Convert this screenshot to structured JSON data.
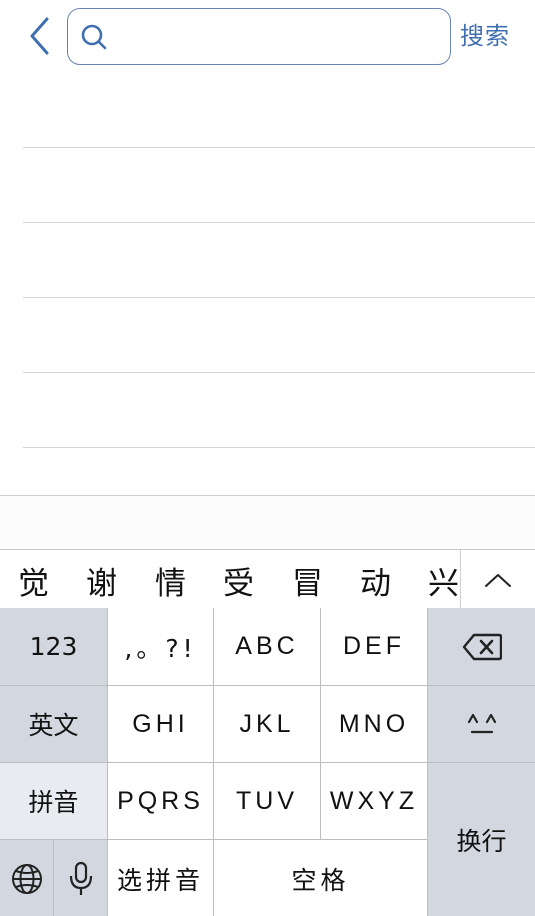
{
  "header": {
    "back_icon": "chevron-left-icon",
    "search_icon": "search-icon",
    "search_value": "",
    "search_placeholder": "",
    "search_button": "搜索",
    "accent_color": "#3f6fb0"
  },
  "results": {
    "row_count": 5
  },
  "keyboard": {
    "candidates": [
      "觉",
      "谢",
      "情",
      "受",
      "冒",
      "动",
      "兴"
    ],
    "expand_icon": "chevron-up-icon",
    "keys": {
      "num": "123",
      "punct": ",。?!",
      "abc": "ABC",
      "def": "DEF",
      "delete_icon": "backspace-icon",
      "english": "英文",
      "ghi": "GHI",
      "jkl": "JKL",
      "mno": "MNO",
      "emoji_icon": "emoticon-icon",
      "pinyin": "拼音",
      "pqrs": "PQRS",
      "tuv": "TUV",
      "wxyz": "WXYZ",
      "enter": "换行",
      "globe_icon": "globe-icon",
      "mic_icon": "microphone-icon",
      "select_pinyin": "选拼音",
      "space": "空格"
    }
  }
}
